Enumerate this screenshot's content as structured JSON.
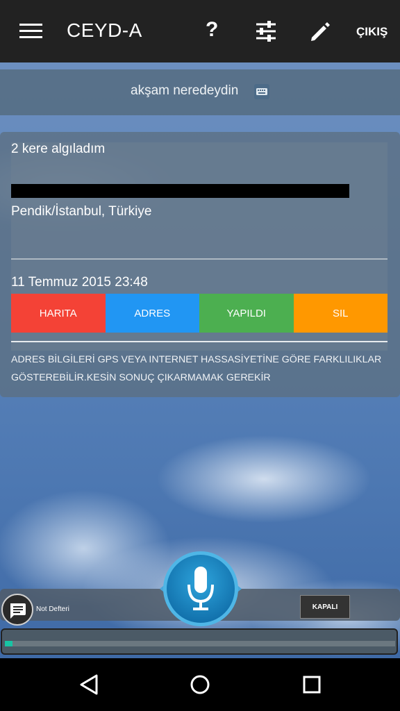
{
  "app": {
    "title": "CEYD-A",
    "logout_label": "ÇIKIŞ",
    "help_symbol": "?"
  },
  "icons": {
    "menu": "menu-icon",
    "help": "help-icon",
    "settings": "sliders-icon",
    "edit": "pencil-icon",
    "keyboard": "keyboard-icon",
    "mic": "microphone-icon",
    "notes": "chat-icon",
    "nav_back": "triangle-back-icon",
    "nav_home": "circle-home-icon",
    "nav_recent": "square-recent-icon"
  },
  "speech": {
    "text": "akşam neredeydin"
  },
  "result": {
    "detect_text": "2 kere algıladım",
    "address_line2": "Pendik/İstanbul, Türkiye",
    "date": "11 Temmuz 2015 23:48",
    "buttons": {
      "map": "HARITA",
      "address": "ADRES",
      "done": "YAPILDI",
      "delete": "SIL"
    },
    "note": "ADRES BİLGİLERİ GPS VEYA INTERNET HASSASİYETİNE GÖRE FARKLILIKLAR GÖSTEREBİLİR.KESİN SONUÇ ÇIKARMAMAK GEREKİR"
  },
  "bottom": {
    "notes_label": "Not Defteri",
    "toggle_label": "KAPALI",
    "progress_fraction": 0.02
  },
  "colors": {
    "map": "#f44236",
    "address": "#2196f3",
    "done": "#4caf50",
    "delete": "#ff9800",
    "progress": "#18c4a4"
  }
}
